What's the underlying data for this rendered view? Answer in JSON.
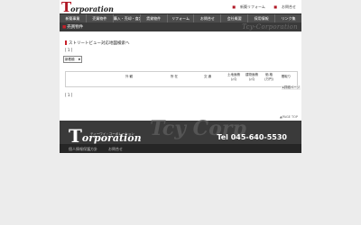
{
  "logo": {
    "letter": "T",
    "rest": "orporation"
  },
  "top_links": [
    "新築リフォーム",
    "お問合せ"
  ],
  "nav": [
    "新築事業",
    "売買物件",
    "購入・売却・査定",
    "賃貸物件",
    "リフォーム",
    "お問合せ",
    "会社概要",
    "採用情報",
    "リンク集"
  ],
  "page": {
    "title": "売買物件",
    "watermark": "Tcy-Corporation"
  },
  "content": {
    "street_link": "ストリートビュー対応地図検索へ",
    "count_top": "[ 1 ]",
    "sort_select": "新着順",
    "headers": [
      "外 観",
      "所 在",
      "交 通",
      "土地面積\n(㎡)",
      "建物面積\n(㎡)",
      "価 格\n(万円)",
      "間取り"
    ],
    "detail_button": "▸詳細ページ",
    "count_bottom": "[ 1 ]",
    "page_top": "▲PAGE TOP"
  },
  "footer": {
    "logo_letter": "T",
    "logo_rest": "orporation",
    "logo_sub": "ティーワイ・コーポレーション",
    "watermark": "Tcy Corp",
    "tel": "Tel 045-640-5530",
    "links": [
      "個人情報保護方針",
      "お問合せ"
    ]
  }
}
